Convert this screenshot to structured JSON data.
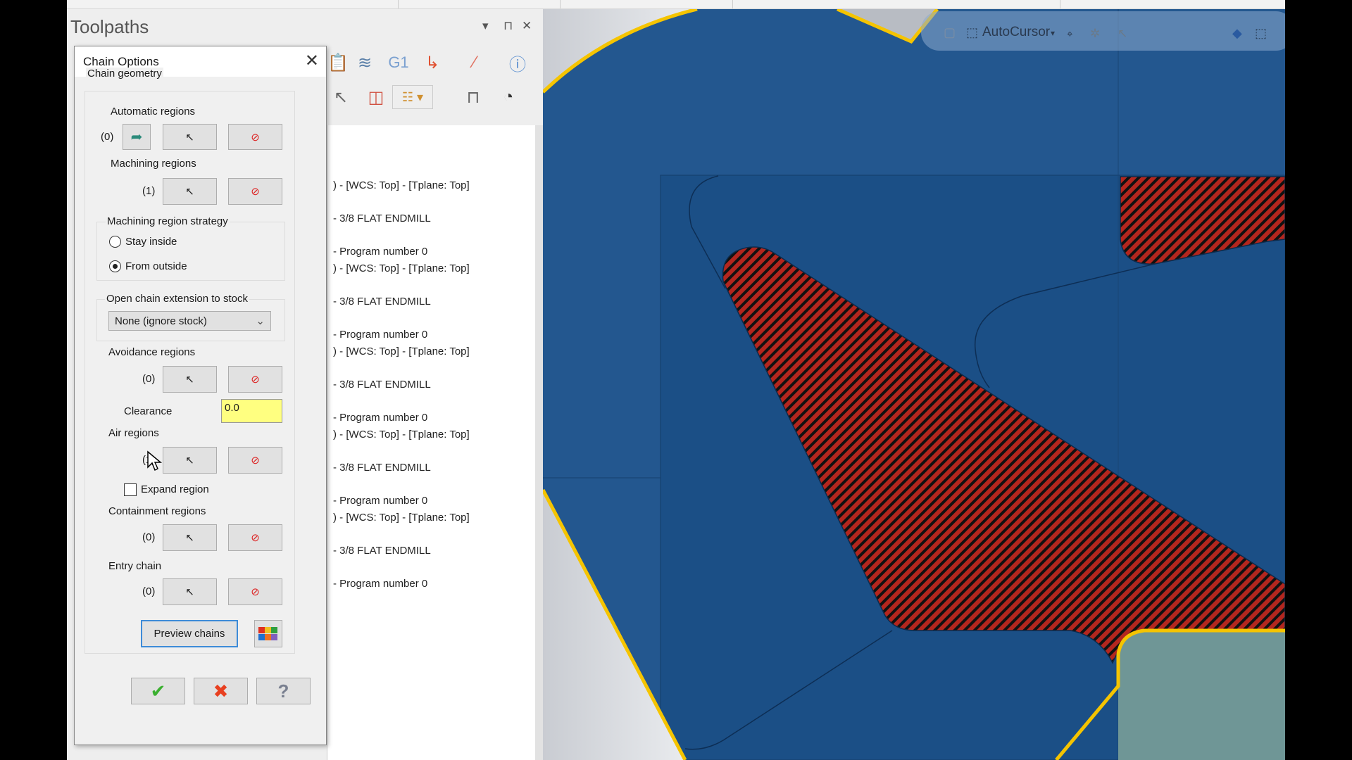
{
  "panel": {
    "title": "Toolpaths",
    "controls": {
      "menu": "▾",
      "pin": "⊓",
      "close": "✕"
    }
  },
  "toolbar_icons": [
    "paste-icon",
    "toolpath-settings-icon",
    "g1-icon",
    "post-icon",
    "edit-icon",
    "help-icon",
    "select-chain-icon",
    "selection-icon",
    "display-options-icon",
    "machine-icon",
    "pie-edit-icon"
  ],
  "toolbar_g1": "G1",
  "list": {
    "items": [
      ") - [WCS: Top] - [Tplane: Top]",
      "-  3/8 FLAT ENDMILL",
      "- Program number 0",
      ") - [WCS: Top] - [Tplane: Top]",
      "-  3/8 FLAT ENDMILL",
      "- Program number 0",
      ") - [WCS: Top] - [Tplane: Top]",
      "-  3/8 FLAT ENDMILL",
      "- Program number 0",
      ") - [WCS: Top] - [Tplane: Top]",
      "-  3/8 FLAT ENDMILL",
      "- Program number 0",
      ") - [WCS: Top] - [Tplane: Top]",
      "-  3/8 FLAT ENDMILL",
      "- Program number 0"
    ]
  },
  "dialog": {
    "title": "Chain Options",
    "close": "✕",
    "chain_geometry": "Chain geometry",
    "automatic": {
      "label": "Automatic regions",
      "count": "(0)"
    },
    "machining": {
      "label": "Machining regions",
      "count": "(1)"
    },
    "strategy": {
      "label": "Machining region strategy",
      "options": [
        "Stay inside",
        "From outside"
      ],
      "selected": "From outside"
    },
    "open_chain": {
      "label": "Open chain extension to stock",
      "value": "None (ignore stock)"
    },
    "avoidance": {
      "label": "Avoidance regions",
      "count": "(0)"
    },
    "clearance": {
      "label": "Clearance",
      "value": "0.0",
      "highlight": "#ffff80"
    },
    "air": {
      "label": "Air regions",
      "count": "(1)"
    },
    "expand": {
      "label": "Expand region",
      "checked": false
    },
    "containment": {
      "label": "Containment regions",
      "count": "(0)"
    },
    "entry": {
      "label": "Entry chain",
      "count": "(0)"
    },
    "preview": "Preview chains",
    "ok": "✔",
    "cancel": "✖",
    "help": "?"
  },
  "viewport": {
    "toolbar": {
      "autocursor": "AutoCursor"
    },
    "colors": {
      "stock": "#23578f",
      "part": "#1b4f86",
      "hatch": "#b3261e",
      "boundary": "#f5c400",
      "fixture": "#6f9696"
    }
  }
}
